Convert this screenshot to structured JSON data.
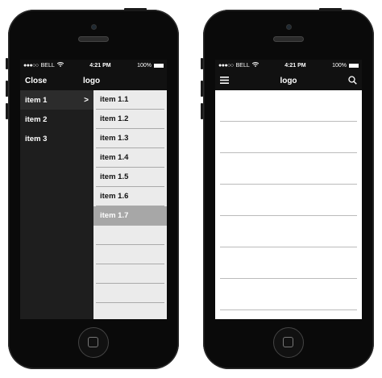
{
  "left_phone": {
    "status": {
      "carrier": "BELL",
      "time": "4:21 PM",
      "battery": "100%"
    },
    "nav": {
      "close_label": "Close",
      "logo": "logo"
    },
    "menu_items": [
      {
        "label": "item 1",
        "chevron": ">"
      },
      {
        "label": "item 2"
      },
      {
        "label": "item 3"
      }
    ],
    "submenu_items": [
      {
        "label": "item 1.1"
      },
      {
        "label": "item 1.2"
      },
      {
        "label": "item 1.3"
      },
      {
        "label": "item 1.4"
      },
      {
        "label": "item 1.5"
      },
      {
        "label": "item 1.6"
      },
      {
        "label": "item 1.7"
      }
    ]
  },
  "right_phone": {
    "status": {
      "carrier": "BELL",
      "time": "4:21 PM",
      "battery": "100%"
    },
    "nav": {
      "logo": "logo",
      "menu_icon": "hamburger-icon",
      "search_icon": "search-icon"
    }
  },
  "colors": {
    "menu_bg": "#1e1e1e",
    "submenu_bg": "#ebebeb",
    "selected_bg": "#a7a7a7"
  }
}
